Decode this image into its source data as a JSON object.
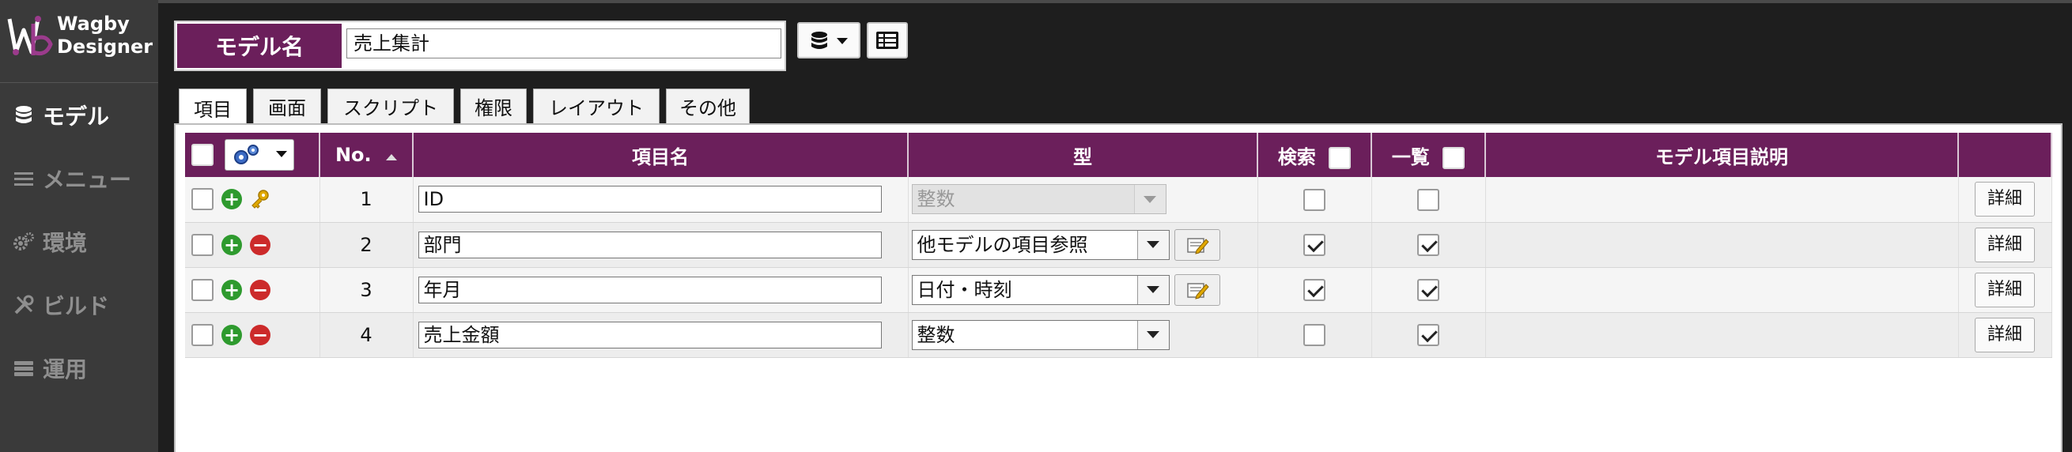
{
  "app": {
    "logo_line1": "Wagby",
    "logo_line2": "Designer"
  },
  "sidebar": {
    "items": [
      {
        "label": "モデル",
        "icon": "database-icon",
        "active": true
      },
      {
        "label": "メニュー",
        "icon": "menu-icon",
        "active": false
      },
      {
        "label": "環境",
        "icon": "gears-icon",
        "active": false
      },
      {
        "label": "ビルド",
        "icon": "tools-icon",
        "active": false
      },
      {
        "label": "運用",
        "icon": "server-icon",
        "active": false
      }
    ]
  },
  "header": {
    "model_label": "モデル名",
    "model_name": "売上集計"
  },
  "tabs": [
    {
      "label": "項目",
      "active": true
    },
    {
      "label": "画面",
      "active": false
    },
    {
      "label": "スクリプト",
      "active": false
    },
    {
      "label": "権限",
      "active": false
    },
    {
      "label": "レイアウト",
      "active": false
    },
    {
      "label": "その他",
      "active": false
    }
  ],
  "table": {
    "columns": {
      "no": "No.",
      "name": "項目名",
      "type": "型",
      "search": "検索",
      "list": "一覧",
      "description": "モデル項目説明"
    },
    "detail_label": "詳細",
    "rows": [
      {
        "no": "1",
        "name": "ID",
        "type": "整数",
        "type_disabled": true,
        "search": false,
        "list": false,
        "description": "",
        "key": true
      },
      {
        "no": "2",
        "name": "部門",
        "type": "他モデルの項目参照",
        "type_disabled": false,
        "search": true,
        "list": true,
        "description": "",
        "key": false
      },
      {
        "no": "3",
        "name": "年月",
        "type": "日付・時刻",
        "type_disabled": false,
        "search": true,
        "list": true,
        "description": "",
        "key": false
      },
      {
        "no": "4",
        "name": "売上金額",
        "type": "整数",
        "type_disabled": false,
        "search": false,
        "list": true,
        "description": "",
        "key": false
      }
    ]
  },
  "colors": {
    "accent": "#6b1f5b",
    "add": "#2e9a2e",
    "remove": "#cc2a2a"
  }
}
